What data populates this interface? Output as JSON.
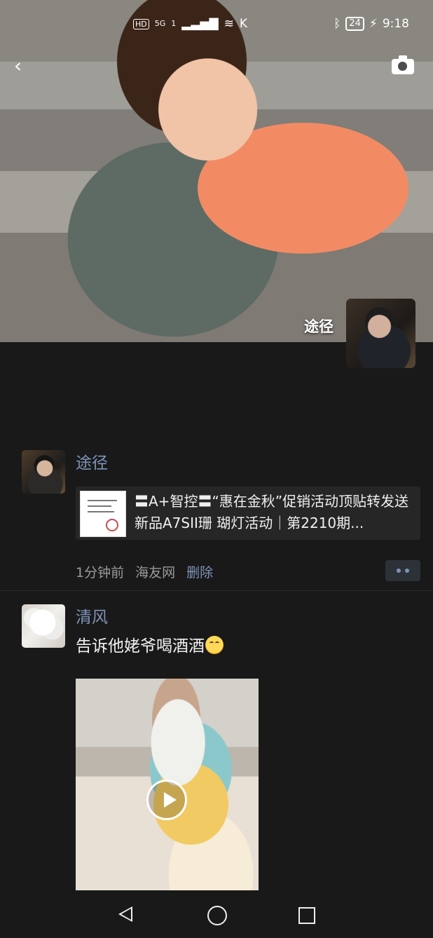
{
  "statusbar": {
    "hd": "HD",
    "network": "5G",
    "signal_small": "1",
    "k_icon": "K",
    "battery": "24",
    "time": "9:18",
    "icons": [
      "signal-icon",
      "wifi-icon",
      "bluetooth-icon",
      "battery-icon",
      "charging-icon"
    ]
  },
  "header": {
    "back_icon": "‹",
    "camera_icon": "camera-icon"
  },
  "cover": {
    "profile_name": "途径"
  },
  "posts": [
    {
      "name": "途径",
      "share_title": "〓A+智控〓“惠在金秋”促销活动顶贴转发送新品A7SII珊 瑚灯活动｜第2210期...",
      "time": "1分钟前",
      "source": "海友网",
      "delete": "删除"
    },
    {
      "name": "清风",
      "text": "告诉他姥爷喝酒酒",
      "emoji": "crying-laughing-emoji",
      "video_icon": "play-icon"
    }
  ],
  "navigation": {
    "back": "back-icon",
    "home": "home-icon",
    "recent": "recent-apps-icon"
  },
  "colors": {
    "background": "#191919",
    "link": "#7e94b8",
    "text": "#f1f1f1",
    "meta": "#9a9a9a"
  }
}
